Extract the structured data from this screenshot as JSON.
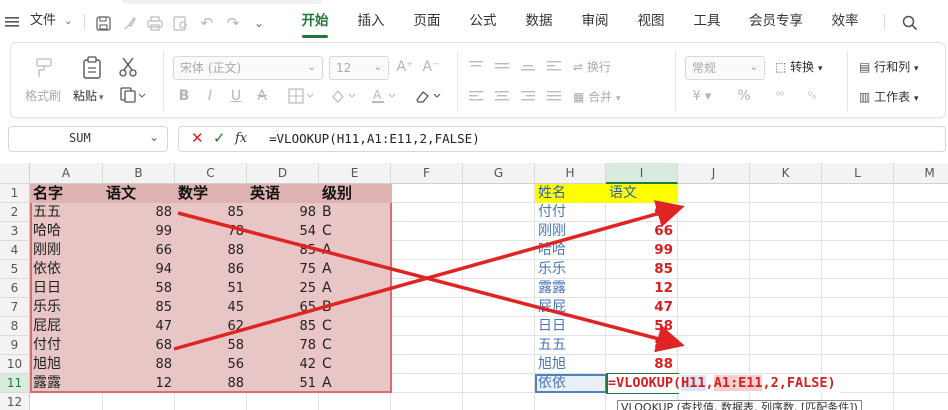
{
  "menubar": {
    "file_label": "文件",
    "tabs": [
      "开始",
      "插入",
      "页面",
      "公式",
      "数据",
      "审阅",
      "视图",
      "工具",
      "会员专享",
      "效率"
    ]
  },
  "ribbon": {
    "format_painter": "格式刷",
    "paste": "粘贴",
    "font_name": "宋体 (正文)",
    "font_size": "12",
    "number_format": "常规",
    "convert": "转换",
    "wrap": "换行",
    "merge": "合并",
    "rows_cols": "行和列",
    "worksheet": "工作表"
  },
  "formula_bar": {
    "name_box": "SUM",
    "fx": "fx",
    "formula": "=VLOOKUP(H11,A1:E11,2,FALSE)"
  },
  "grid": {
    "columns": [
      "A",
      "B",
      "C",
      "D",
      "E",
      "F",
      "G",
      "H",
      "I",
      "J",
      "K",
      "L",
      "M"
    ],
    "rows": [
      "1",
      "2",
      "3",
      "4",
      "5",
      "6",
      "7",
      "8",
      "9",
      "10",
      "11",
      "12"
    ],
    "source_headers": [
      "名字",
      "语文",
      "数学",
      "英语",
      "级别"
    ],
    "source_rows": [
      [
        "五五",
        "88",
        "85",
        "98",
        "B"
      ],
      [
        "哈哈",
        "99",
        "78",
        "54",
        "C"
      ],
      [
        "刚刚",
        "66",
        "88",
        "85",
        "A"
      ],
      [
        "依依",
        "94",
        "86",
        "75",
        "A"
      ],
      [
        "日日",
        "58",
        "51",
        "25",
        "A"
      ],
      [
        "乐乐",
        "85",
        "45",
        "65",
        "B"
      ],
      [
        "屁屁",
        "47",
        "62",
        "85",
        "C"
      ],
      [
        "付付",
        "68",
        "58",
        "78",
        "C"
      ],
      [
        "旭旭",
        "88",
        "56",
        "42",
        "C"
      ],
      [
        "露露",
        "12",
        "88",
        "51",
        "A"
      ]
    ],
    "lookup_headers": [
      "姓名",
      "语文"
    ],
    "lookup_names": [
      "付付",
      "刚刚",
      "哈哈",
      "乐乐",
      "露露",
      "屁屁",
      "日日",
      "五五",
      "旭旭",
      "依依"
    ],
    "lookup_results": [
      "68",
      "66",
      "99",
      "85",
      "12",
      "47",
      "58",
      "88",
      "88"
    ],
    "cell_formula": {
      "prefix": "=VLOOKUP(",
      "ref1": "H11",
      "sep1": ",",
      "ref2": "A1:E11",
      "suffix": ",2,FALSE)"
    },
    "tooltip": "VLOOKUP (查找值, 数据表, 列序数, [匹配条件])"
  },
  "colors": {
    "accent": "#1f7a3a",
    "source_fill": "#e9c6c6",
    "header_yellow": "#ffff00",
    "result_red": "#d42020",
    "name_blue": "#4a76b8",
    "arrow_red": "#e02424"
  }
}
